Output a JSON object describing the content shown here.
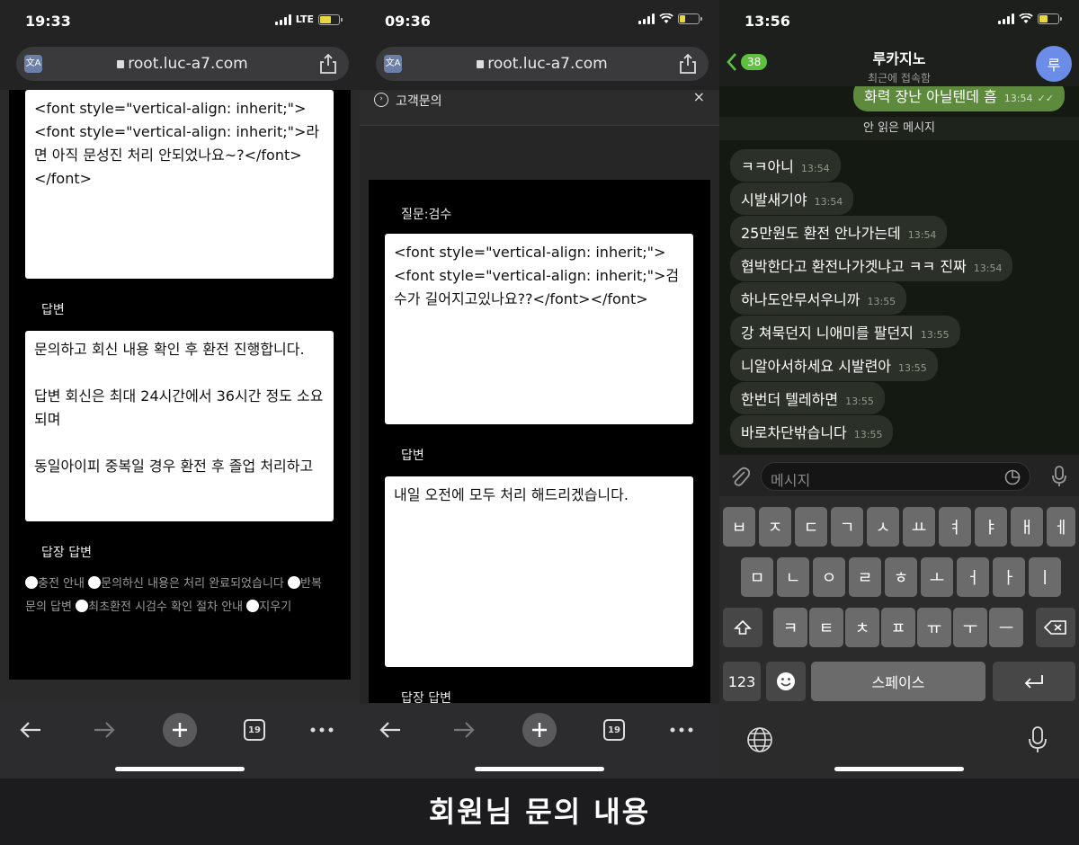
{
  "panel1": {
    "status": {
      "time": "19:33",
      "network": "LTE"
    },
    "url": "root.luc-a7.com",
    "tabs_count": "19",
    "question_text": "<font style=\"vertical-align: inherit;\"><font style=\"vertical-align: inherit;\">라면 아직 문성진 처리 안되었나요~?</font></font>",
    "answer_label": "답변",
    "answer_text_1": "문의하고 회신 내용 확인 후 환전 진행합니다.",
    "answer_text_2": "답변 회신은 최대 24시간에서 36시간 정도 소요되며",
    "answer_text_3": "동일아이피 중복일 경우 환전 후 졸업 처리하고",
    "reply_label": "답장 답변",
    "radio_options": [
      "충전 안내",
      "문의하신 내용은 처리 완료되었습니다",
      "반복 문의 답변",
      "최초환전 시검수 확인 절차 안내",
      "지우기"
    ]
  },
  "panel2": {
    "status": {
      "time": "09:36"
    },
    "url": "root.luc-a7.com",
    "tabs_count": "19",
    "notice_text": "고객문의",
    "close_label": "×",
    "question_label": "질문:검수",
    "question_text": "<font style=\"vertical-align: inherit;\"><font style=\"vertical-align: inherit;\">검수가 길어지고있나요??</font></font>",
    "answer_label": "답변",
    "answer_text": "내일 오전에 모두 처리 해드리겠습니다.",
    "reply_label": "답장 답변"
  },
  "panel3": {
    "status": {
      "time": "13:56"
    },
    "back_count": "38",
    "contact_name": "루카지노",
    "contact_status": "최근에 접속함",
    "avatar_letter": "루",
    "outgoing": {
      "text": "화력 장난 아닐텐데 흠",
      "time": "13:54"
    },
    "unread_label": "안 읽은 메시지",
    "messages": [
      {
        "text": "ㅋㅋ아니",
        "time": "13:54"
      },
      {
        "text": "시발새기야",
        "time": "13:54"
      },
      {
        "text": "25만원도 환전 안나가는데",
        "time": "13:54"
      },
      {
        "text": "협박한다고 환전나가겟냐고 ㅋㅋ 진짜",
        "time": "13:54"
      },
      {
        "text": "하나도안무서우니까",
        "time": "13:55"
      },
      {
        "text": "강 쳐묵던지 니애미를 팔던지",
        "time": "13:55"
      },
      {
        "text": "니알아서하세요 시발련아",
        "time": "13:55"
      },
      {
        "text": "한번더 텔레하면",
        "time": "13:55"
      },
      {
        "text": "바로차단밖습니다",
        "time": "13:55"
      }
    ],
    "input_placeholder": "메시지",
    "keyboard": {
      "row1": [
        "ㅂ",
        "ㅈ",
        "ㄷ",
        "ㄱ",
        "ㅅ",
        "ㅛ",
        "ㅕ",
        "ㅑ",
        "ㅐ",
        "ㅔ"
      ],
      "row2": [
        "ㅁ",
        "ㄴ",
        "ㅇ",
        "ㄹ",
        "ㅎ",
        "ㅗ",
        "ㅓ",
        "ㅏ",
        "ㅣ"
      ],
      "row3": [
        "ㅋ",
        "ㅌ",
        "ㅊ",
        "ㅍ",
        "ㅠ",
        "ㅜ",
        "ㅡ"
      ],
      "num_label": "123",
      "space_label": "스페이스"
    }
  },
  "caption": "회원님 문의 내용",
  "colors": {
    "accent_green": "#5fbf3f",
    "telegram_bubble_out": "#5d8a3c",
    "avatar": "#6b8de8"
  }
}
